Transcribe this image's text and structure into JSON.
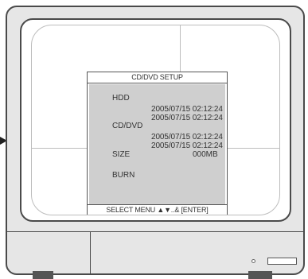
{
  "osd": {
    "title": "CD/DVD SETUP",
    "hdd_label": "HDD",
    "hdd_start": "2005/07/15  02:12:24",
    "hdd_end": "2005/07/15  02:12:24",
    "cd_label": "CD/DVD",
    "cd_start": "2005/07/15  02:12:24",
    "cd_end": "2005/07/15  02:12:24",
    "size_label": "SIZE",
    "size_value": "000MB",
    "burn_label": "BURN",
    "footer": "SELECT MENU ▲▼..& [ENTER]"
  },
  "colors": {
    "panel_body": "#cfcfcf",
    "casing": "#e6e6e6",
    "outline": "#4a4a4a"
  },
  "icons": {
    "pointer": "arrow-right-icon",
    "power_led": "power-indicator-icon",
    "disc_slot": "disc-slot-icon"
  }
}
